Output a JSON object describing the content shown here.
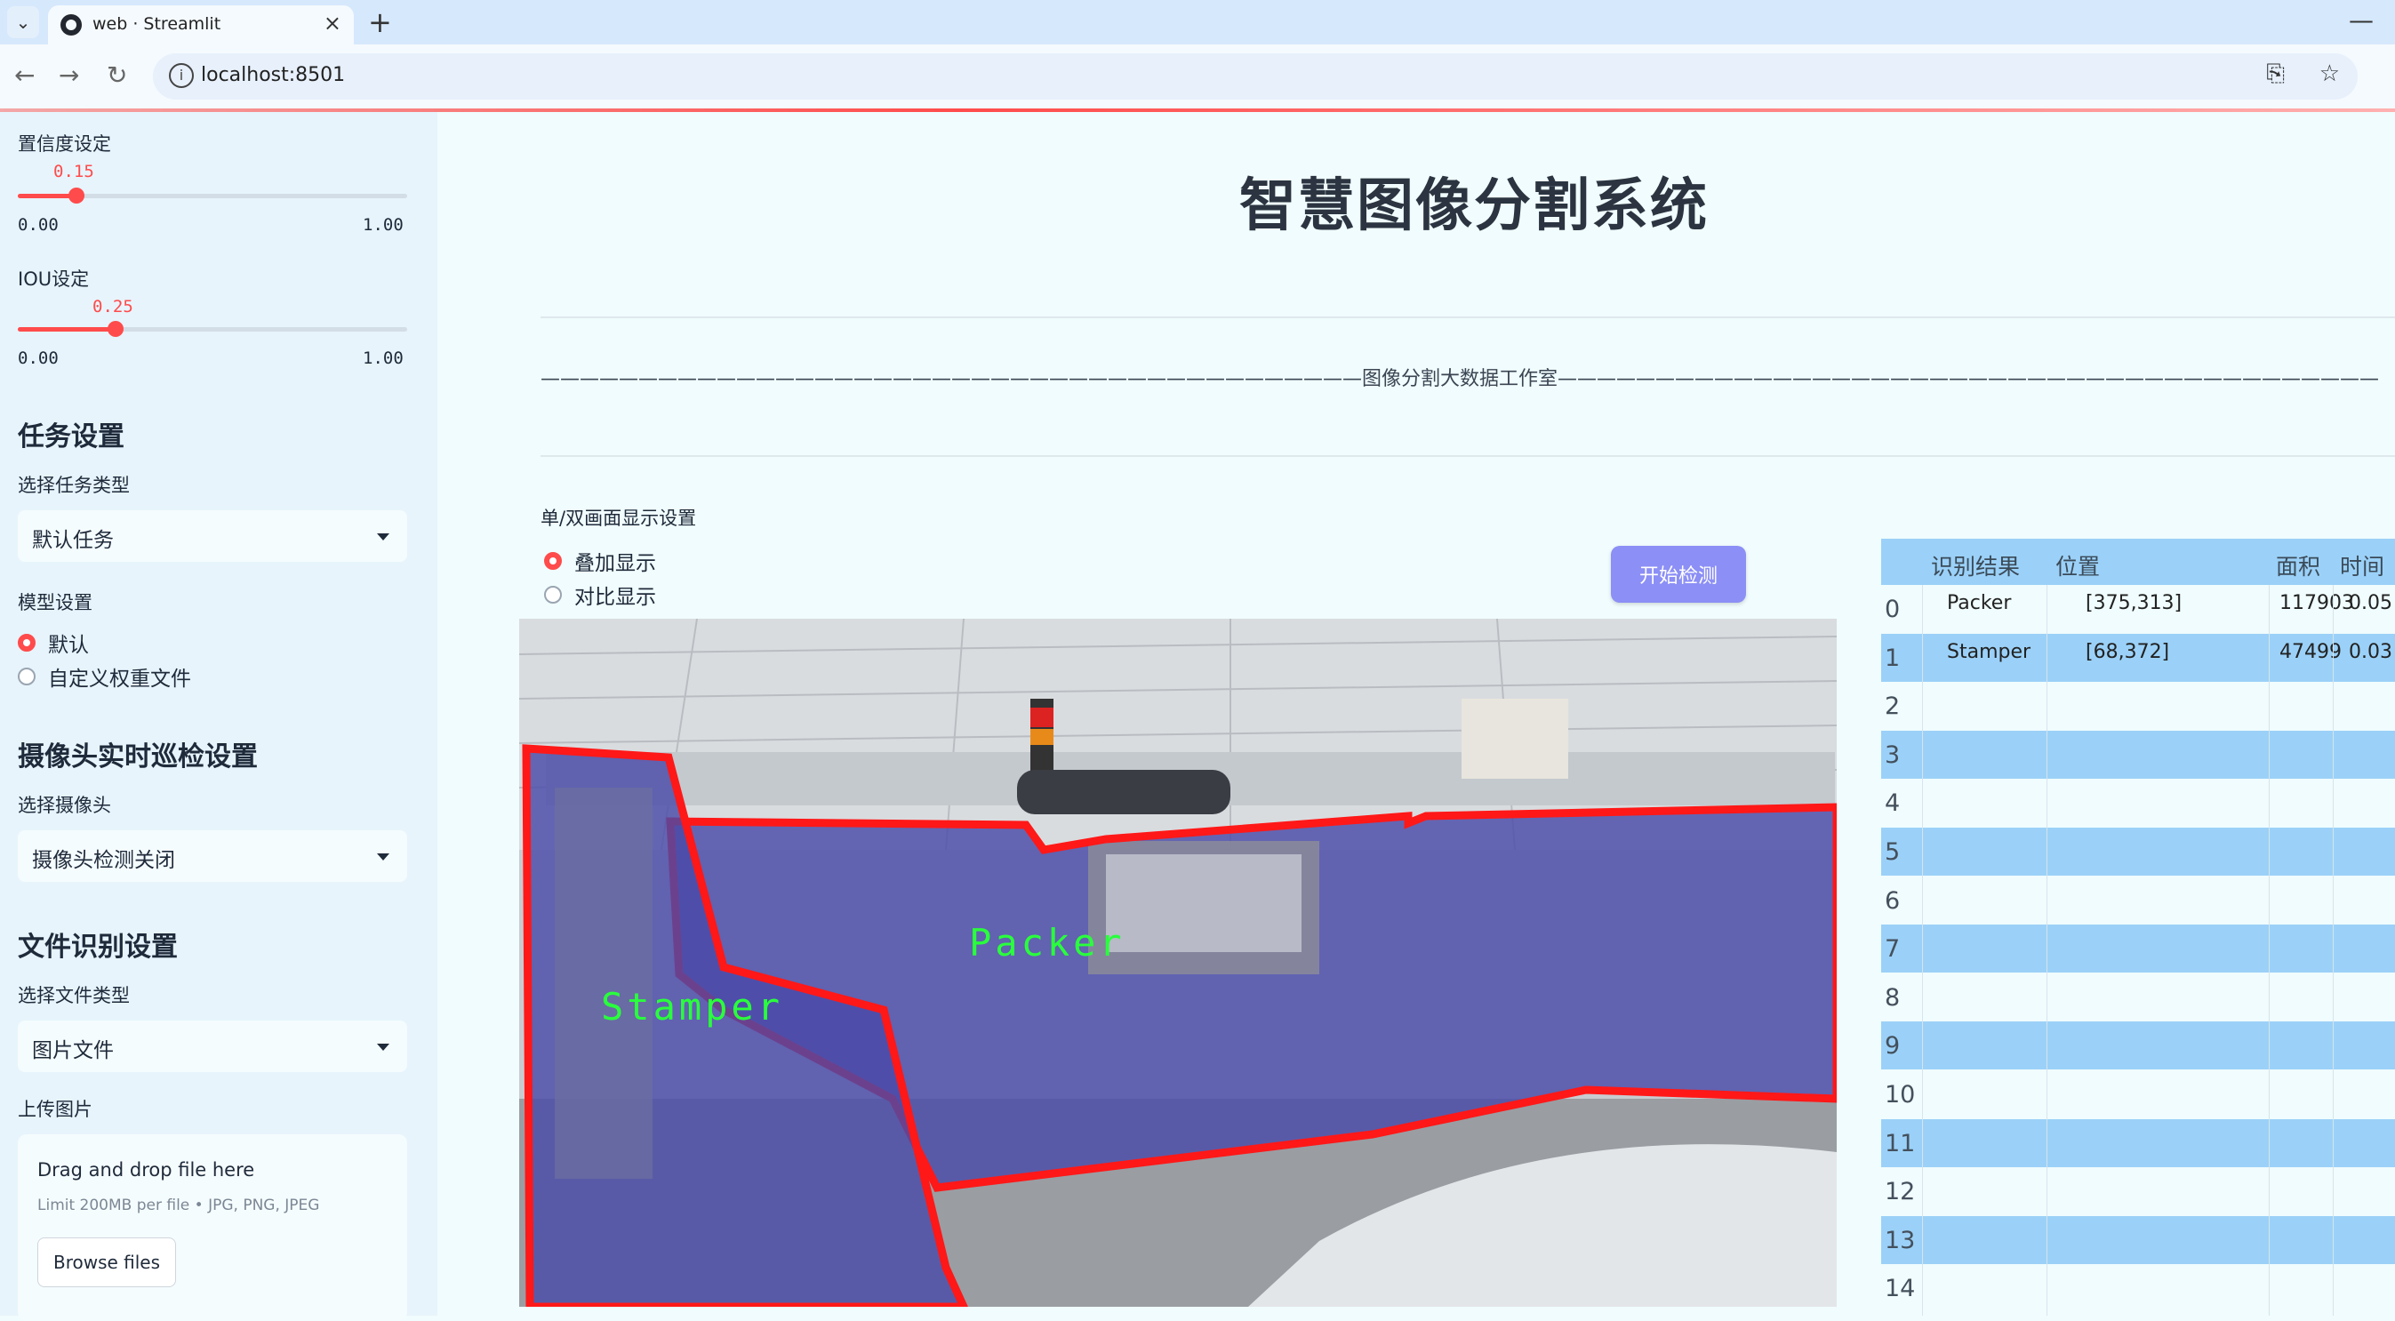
{
  "browser": {
    "tab_title": "web · Streamlit",
    "url": "localhost:8501"
  },
  "sidebar": {
    "confidence": {
      "label": "置信度设定",
      "value": "0.15",
      "min": "0.00",
      "max": "1.00",
      "fraction": 0.15
    },
    "iou": {
      "label": "IOU设定",
      "value": "0.25",
      "min": "0.00",
      "max": "1.00",
      "fraction": 0.25
    },
    "task_heading": "任务设置",
    "task_type_label": "选择任务类型",
    "task_type_value": "默认任务",
    "model_label": "模型设置",
    "model_options": [
      {
        "label": "默认",
        "selected": true
      },
      {
        "label": "自定义权重文件",
        "selected": false
      }
    ],
    "camera_heading": "摄像头实时巡检设置",
    "camera_label": "选择摄像头",
    "camera_value": "摄像头检测关闭",
    "file_heading": "文件识别设置",
    "file_type_label": "选择文件类型",
    "file_type_value": "图片文件",
    "upload_label": "上传图片",
    "upload_main": "Drag and drop file here",
    "upload_sub": "Limit 200MB per file • JPG, PNG, JPEG",
    "upload_button": "Browse files"
  },
  "main": {
    "title": "智慧图像分割系统",
    "subtitle": "——————————————————————————————————————————图像分割大数据工作室——————————————————————————————————————————",
    "display_mode_label": "单/双画面显示设置",
    "display_modes": [
      {
        "label": "叠加显示",
        "selected": true
      },
      {
        "label": "对比显示",
        "selected": false
      }
    ],
    "start_button": "开始检测",
    "detections": [
      "Stamper",
      "Packer"
    ]
  },
  "table": {
    "headers": [
      "识别结果",
      "位置",
      "面积",
      "时间"
    ],
    "rows": [
      {
        "idx": "0",
        "result": "Packer",
        "position": "[375,313]",
        "area": "117903",
        "time": "0.05"
      },
      {
        "idx": "1",
        "result": "Stamper",
        "position": "[68,372]",
        "area": "47499",
        "time": "0.03"
      },
      {
        "idx": "2"
      },
      {
        "idx": "3"
      },
      {
        "idx": "4"
      },
      {
        "idx": "5"
      },
      {
        "idx": "6"
      },
      {
        "idx": "7"
      },
      {
        "idx": "8"
      },
      {
        "idx": "9"
      },
      {
        "idx": "10"
      },
      {
        "idx": "11"
      },
      {
        "idx": "12"
      },
      {
        "idx": "13"
      },
      {
        "idx": "14"
      }
    ]
  },
  "colors": {
    "accent": "#ff4b4b",
    "button": "#8c8ff5",
    "table_stripe": "#9bd1f8",
    "mask": "#3a3ac8",
    "label_green": "#29ff3c"
  }
}
